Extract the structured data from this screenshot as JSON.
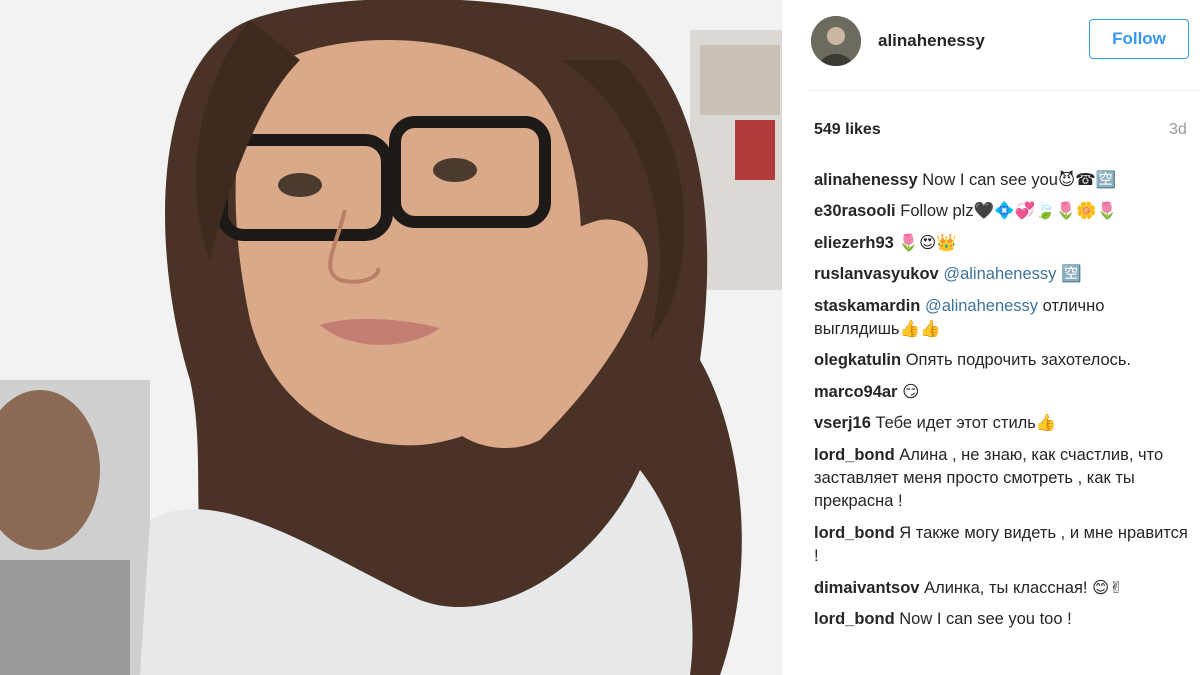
{
  "post": {
    "author": "alinahenessy",
    "follow_label": "Follow",
    "likes_text": "549 likes",
    "time_ago": "3d"
  },
  "photo": {
    "description_icon": "selfie-photo"
  },
  "comments": [
    {
      "user": "alinahenessy",
      "text": "Now I can see you😈☎🈳"
    },
    {
      "user": "e30rasooli",
      "text": "Follow plz🖤💠💞🍃🌷🌼🌷"
    },
    {
      "user": "eliezerh93",
      "text": "🌷😍👑"
    },
    {
      "user": "ruslanvasyukov",
      "mention": "@alinahenessy",
      "text": "🈳"
    },
    {
      "user": "staskamardin",
      "mention": "@alinahenessy",
      "text": "отлично выглядишь👍👍"
    },
    {
      "user": "olegkatulin",
      "text": "Опять подрочить захотелось."
    },
    {
      "user": "marco94ar",
      "text": "😏"
    },
    {
      "user": "vserj16",
      "text": "Тебе идет этот стиль👍"
    },
    {
      "user": "lord_bond",
      "text": "Алина , не знаю, как счастлив, что заставляет меня просто смотреть , как ты прекрасна !"
    },
    {
      "user": "lord_bond",
      "text": "Я также могу видеть , и мне нравится !"
    },
    {
      "user": "dimaivantsov",
      "text": "Алинка, ты классная! 😊✌"
    },
    {
      "user": "lord_bond",
      "text": "Now I can see you too !"
    }
  ],
  "colors": {
    "accent_blue": "#3897f0",
    "mention_blue": "#3f729b",
    "text_dark": "#262626",
    "muted": "#999999"
  }
}
